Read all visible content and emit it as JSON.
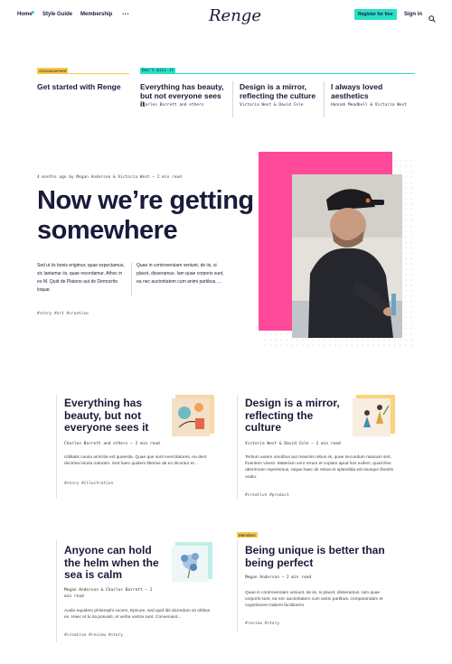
{
  "header": {
    "nav": [
      "Home",
      "Style Guide",
      "Membership"
    ],
    "more": "···",
    "logo": "Renge",
    "register": "Register for free",
    "signin": "Sign in"
  },
  "featured": {
    "tag_announcement": "Announcement",
    "tag_dont_miss": "Don't miss it",
    "items": [
      {
        "title": "Get started with Renge",
        "meta": ""
      },
      {
        "title": "Everything has beauty, but not everyone sees it",
        "meta": "Charles Barrett and others"
      },
      {
        "title": "Design is a mirror, reflecting the culture",
        "meta": "Victoria West & David Cole"
      },
      {
        "title": "I always loved aesthetics",
        "meta": "Hannah Meadbell & Victoria West"
      }
    ]
  },
  "hero": {
    "meta": "4 months ago by Megan Anderson & Victoria West — 2 min read",
    "title": "Now we’re getting somewhere",
    "para1": "Sed ut iis bonis erigimur, quae expectamus, sic laetamur iis, quae recordamur. Athoc in eo M. Quid de Platone aut de Democrito loquar.",
    "para2": "Quae in controversiam veniunt, de iis, si placet, disseramus. Iam quae corporis sunt, ea nec auctoritatem cum animi partibus, ...",
    "tags": "#story  #art  #creative"
  },
  "cards": [
    {
      "title": "Everything has beauty, but not everyone sees it",
      "meta": "Charles Barrett and others — 2 min read",
      "excerpt": "Utilitatis causa amicitia est quaesita. Quae que sunt exercitatores, ea dent doctrina iniuria naturam. Sed haec quidem liberius ab eo dicuntur et...",
      "tags": "#story  #illustration"
    },
    {
      "title": "Design is a mirror, reflecting the culture",
      "meta": "Victoria West & David Cole — 2 min read",
      "excerpt": "Tertium autem omnibus aut maximis rebus iis, quae secundum naturam sint, fruentem vivere. Materiam vero rerum et copiam apud hos exilem, quod illos uberrimam reperiemus. Atque haec de rebus et splendida est eiusque illustris oratio.",
      "tags": "#creative  #product"
    },
    {
      "badge": "",
      "title": "Anyone can hold the helm when the sea is calm",
      "meta": "Megan Anderson & Charles Barrett — 2 min read",
      "excerpt": "Audio equidem philosophi vocem, Epicure, sed quid tibi dicendum sit oblitus es. Haec et tu ita posuisti, et verba vestra sunt. Conveniunt...",
      "tags": "#creative  #review  #story"
    },
    {
      "badge": "Members",
      "title": "Being unique is better than being perfect",
      "meta": "Megan Anderson — 2 min read",
      "excerpt": "Quae in controversiam veniunt, de iis, si placet, disseramus. Iam quae corporis sunt, ea nec auctoritatem cum animi partibus, comparandam et cognitionem habent facilitorem.",
      "tags": "#review  #story"
    }
  ],
  "colors": {
    "accent": "#28e0c6",
    "pink": "#ff4a9a",
    "yellow": "#f6c94a",
    "navy": "#1a1a3a"
  }
}
